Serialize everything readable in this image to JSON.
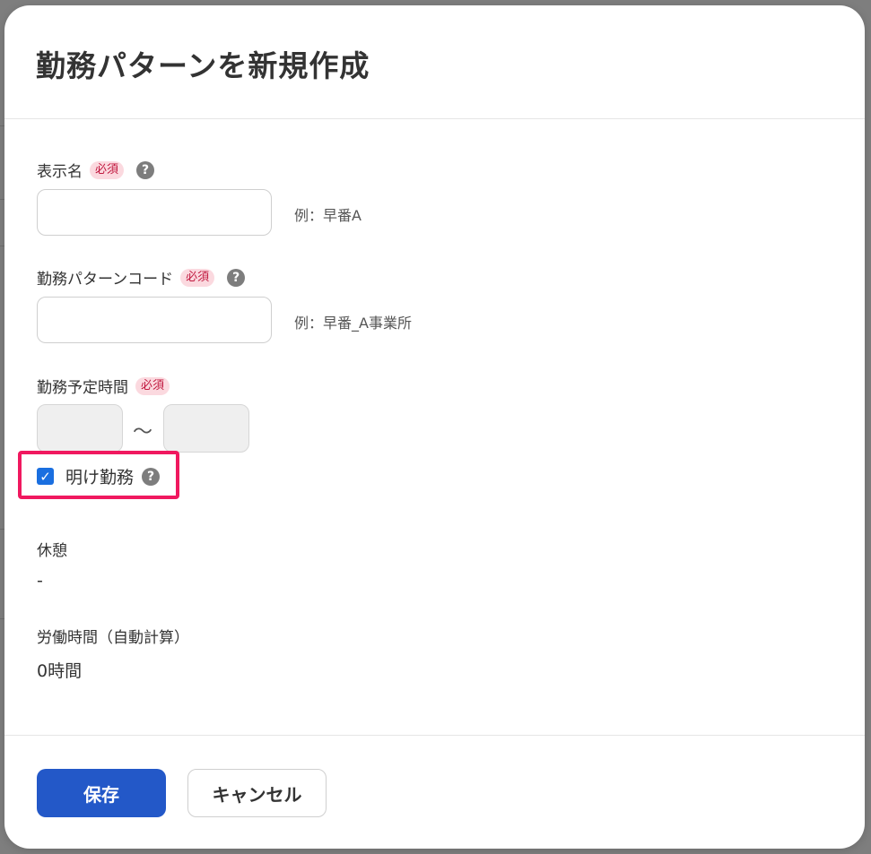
{
  "modal": {
    "title": "勤務パターンを新規作成"
  },
  "form": {
    "display_name": {
      "label": "表示名",
      "required_badge": "必須",
      "help_icon": "?",
      "value": "",
      "example": "例：早番A"
    },
    "pattern_code": {
      "label": "勤務パターンコード",
      "required_badge": "必須",
      "help_icon": "?",
      "value": "",
      "example": "例：早番_A事業所"
    },
    "scheduled_time": {
      "label": "勤務予定時間",
      "required_badge": "必須",
      "separator": "〜"
    },
    "overnight_shift": {
      "label": "明け勤務",
      "checked": true,
      "check_glyph": "✓",
      "help_icon": "?"
    },
    "break": {
      "label": "休憩",
      "value": "-"
    },
    "working_hours": {
      "label": "労働時間（自動計算）",
      "value": "0時間"
    }
  },
  "footer": {
    "save_label": "保存",
    "cancel_label": "キャンセル"
  },
  "colors": {
    "primary": "#2358c8",
    "highlight": "#f0185f",
    "required_badge_bg": "#fbd9df",
    "required_badge_text": "#c0173e"
  },
  "icons": {
    "help": "question-circle-icon",
    "checkbox": "checkbox-checked-icon"
  }
}
